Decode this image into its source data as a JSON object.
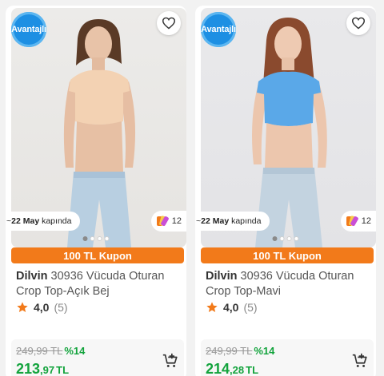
{
  "products": [
    {
      "badge": "Avantajlı",
      "delivery_prefix": "~",
      "delivery_date": "22 May",
      "delivery_suffix": "kapında",
      "count": "12",
      "coupon": "100 TL Kupon",
      "brand": "Dilvin",
      "name": "30936 Vücuda Oturan Crop Top-Açık Bej",
      "rating": "4,0",
      "rating_count": "(5)",
      "old_price": "249,99 TL",
      "discount": "%14",
      "price_int": "213",
      "price_dec": ",97",
      "currency": "TL",
      "top_color": "#f3d2b3"
    },
    {
      "badge": "Avantajlı",
      "delivery_prefix": "~",
      "delivery_date": "22 May",
      "delivery_suffix": "kapında",
      "count": "12",
      "coupon": "100 TL Kupon",
      "brand": "Dilvin",
      "name": "30936 Vücuda Oturan Crop Top-Mavi",
      "rating": "4,0",
      "rating_count": "(5)",
      "old_price": "249,99 TL",
      "discount": "%14",
      "price_int": "214",
      "price_dec": ",28",
      "currency": "TL",
      "top_color": "#5aa8e8"
    }
  ],
  "colors": {
    "accent": "#f27a1a",
    "price_green": "#12a33c",
    "badge_blue": "#1d8fe3",
    "star": "#f27a1a"
  },
  "icons": [
    "heart-icon",
    "star-icon",
    "add-to-cart-icon",
    "color-swatch-icon"
  ]
}
